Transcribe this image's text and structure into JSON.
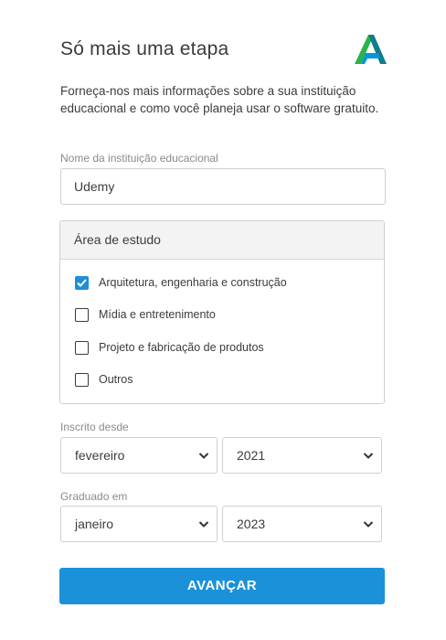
{
  "header": {
    "title": "Só mais uma etapa",
    "logo_icon": "autodesk-logo-icon"
  },
  "description": "Forneça-nos mais informações sobre a sua instituição educacional e como você planeja usar o software gratuito.",
  "institution": {
    "label": "Nome da instituição educacional",
    "value": "Udemy"
  },
  "area_of_study": {
    "title": "Área de estudo",
    "options": [
      {
        "label": "Arquitetura, engenharia e construção",
        "checked": true
      },
      {
        "label": "Mídia e entretenimento",
        "checked": false
      },
      {
        "label": "Projeto e fabricação de produtos",
        "checked": false
      },
      {
        "label": "Outros",
        "checked": false
      }
    ]
  },
  "enrolled_since": {
    "label": "Inscrito desde",
    "month": "fevereiro",
    "year": "2021"
  },
  "graduated_in": {
    "label": "Graduado em",
    "month": "janeiro",
    "year": "2023"
  },
  "submit_label": "AVANÇAR",
  "colors": {
    "accent": "#1a91d9",
    "checkbox_checked": "#1e8fd6",
    "logo_green": "#2bb24c",
    "logo_teal": "#0f7d8c",
    "logo_blue": "#0696d7"
  }
}
